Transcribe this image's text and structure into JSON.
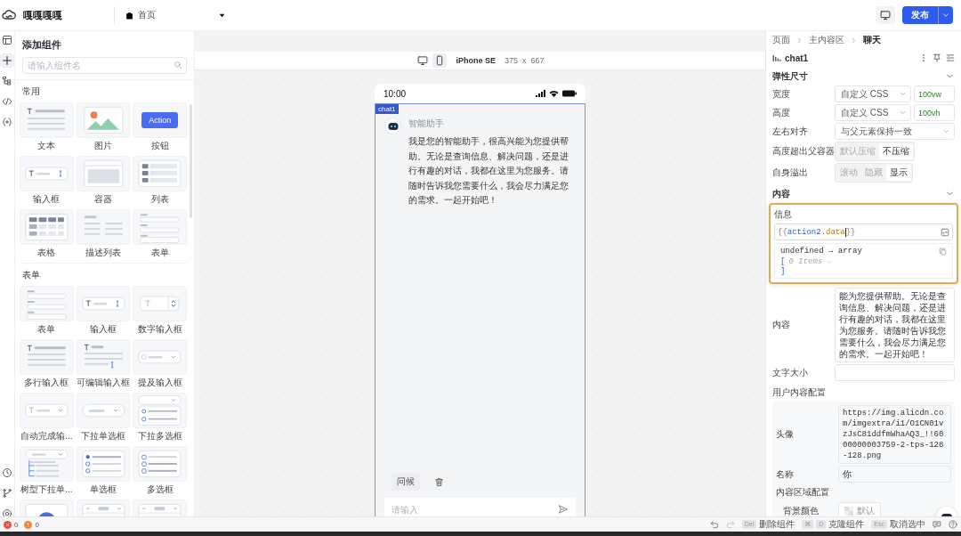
{
  "app": {
    "name": "嘎嘎嘎嘎",
    "page": "首页",
    "publish": "发布"
  },
  "rail": {
    "top": [
      {
        "kind": "layout",
        "selected": false
      },
      {
        "kind": "plus",
        "selected": true
      },
      {
        "kind": "tree",
        "selected": false
      },
      {
        "kind": "code",
        "selected": false
      },
      {
        "kind": "variable",
        "selected": false
      }
    ],
    "bottom": [
      {
        "kind": "history",
        "selected": false
      },
      {
        "kind": "branch",
        "selected": false
      },
      {
        "kind": "target",
        "selected": false
      }
    ]
  },
  "component_panel": {
    "title": "添加组件",
    "search_placeholder": "请输入组件名",
    "sections": [
      {
        "title": "常用",
        "button_preview": "Action",
        "items": [
          {
            "kind": "text",
            "label": "文本"
          },
          {
            "kind": "image",
            "label": "图片"
          },
          {
            "kind": "button",
            "label": "按钮"
          },
          {
            "kind": "input",
            "label": "输入框"
          },
          {
            "kind": "container",
            "label": "容器"
          },
          {
            "kind": "list",
            "label": "列表"
          },
          {
            "kind": "table",
            "label": "表格"
          },
          {
            "kind": "desc",
            "label": "描述列表"
          },
          {
            "kind": "form",
            "label": "表单"
          }
        ]
      },
      {
        "title": "表单",
        "items": [
          {
            "kind": "form",
            "label": "表单"
          },
          {
            "kind": "input",
            "label": "输入框"
          },
          {
            "kind": "number",
            "label": "数字输入框"
          },
          {
            "kind": "textarea",
            "label": "多行输入框"
          },
          {
            "kind": "editable",
            "label": "可编辑输入框"
          },
          {
            "kind": "mention",
            "label": "提及输入框"
          },
          {
            "kind": "autocomplete",
            "label": "自动完成输..."
          },
          {
            "kind": "select",
            "label": "下拉单选框"
          },
          {
            "kind": "multiselect",
            "label": "下拉多选框"
          },
          {
            "kind": "treeselect",
            "label": "树型下拉单..."
          },
          {
            "kind": "radio",
            "label": "单选框"
          },
          {
            "kind": "checkbox",
            "label": "多选框"
          },
          {
            "kind": "avatar"
          },
          {
            "kind": "pagination"
          },
          {
            "kind": "pagination"
          }
        ]
      }
    ]
  },
  "canvas": {
    "views": [
      {
        "kind": "desktop",
        "selected": false
      },
      {
        "kind": "mobile",
        "selected": true
      }
    ],
    "device": "iPhone SE",
    "size": "375  x  667"
  },
  "phone": {
    "time": "10:00",
    "component_tag": "chat1",
    "assistant_name": "智能助手",
    "message": "我是您的智能助手，很高兴能为您提供帮助。无论是查询信息、解决问题，还是进行有趣的对话，我都在这里为您服务。请随时告诉我您需要什么，我会尽力满足您的需求。一起开始吧！",
    "quick_replies": [
      "问候"
    ],
    "input_placeholder": "请输入"
  },
  "inspector": {
    "breadcrumb": [
      "页面",
      "主内容区",
      "聊天"
    ],
    "component": "chat1",
    "layout_section": {
      "title": "弹性尺寸",
      "expanded": true,
      "rows": [
        {
          "kind": "select_value",
          "label": "宽度",
          "select": "自定义 CSS",
          "value": "100vw"
        },
        {
          "kind": "select_value",
          "label": "高度",
          "select": "自定义 CSS",
          "value": "100vh"
        },
        {
          "kind": "select",
          "label": "左右对齐",
          "select": "与父元素保持一致"
        },
        {
          "kind": "segmented",
          "label": "高度超出父容器",
          "options": [
            {
              "label": "默认压缩",
              "selected": false
            },
            {
              "label": "不压缩",
              "selected": true
            }
          ]
        },
        {
          "kind": "segmented",
          "label": "自身溢出",
          "options": [
            {
              "label": "滚动",
              "selected": false
            },
            {
              "label": "隐藏",
              "selected": false
            },
            {
              "label": "显示",
              "selected": true
            }
          ]
        }
      ]
    },
    "content_section": {
      "title": "内容",
      "expanded": true,
      "binding": {
        "label": "信息",
        "tokens": [
          {
            "kind": "brace",
            "text": "{{"
          },
          {
            "kind": "variable",
            "text": "action2"
          },
          {
            "kind": "punct",
            "text": "."
          },
          {
            "kind": "property",
            "text": "data"
          },
          {
            "kind": "brace",
            "text": "}}"
          }
        ],
        "suggestion": {
          "type_line": "undefined → array",
          "open": "[",
          "items": "0 Items",
          "close": "]"
        }
      },
      "rows": [
        {
          "kind": "textarea",
          "label": "内容",
          "value": "能为您提供帮助。无论是查询信息、解决问题，还是进行有趣的对话，我都在这里为您服务。请随时告诉我您需要什么，我会尽力满足您的需求。一起开始吧！"
        },
        {
          "kind": "input",
          "label": "文字大小"
        }
      ]
    },
    "user_section": {
      "title": "用户内容配置",
      "rows": [
        {
          "kind": "code",
          "label": "头像",
          "value": "https://img.alicdn.com/imgextra/i1/O1CN01vzJsC81ddfmWhaAQ3_!!6000000003759-2-tps-128-128.png"
        },
        {
          "kind": "input",
          "label": "名称",
          "value": "你"
        }
      ],
      "subsection": {
        "title": "内容区域配置",
        "rows": [
          {
            "kind": "color",
            "label": "背景颜色",
            "value": "默认"
          }
        ]
      }
    }
  },
  "status_bar": {
    "errors": "0",
    "warnings": "0",
    "shortcuts": [
      {
        "keys": [
          "Del"
        ],
        "label": "删除组件"
      },
      {
        "keys": [
          "⌘",
          "D"
        ],
        "label": "克隆组件"
      },
      {
        "keys": [
          "Esc"
        ],
        "label": "取消选中"
      }
    ]
  }
}
